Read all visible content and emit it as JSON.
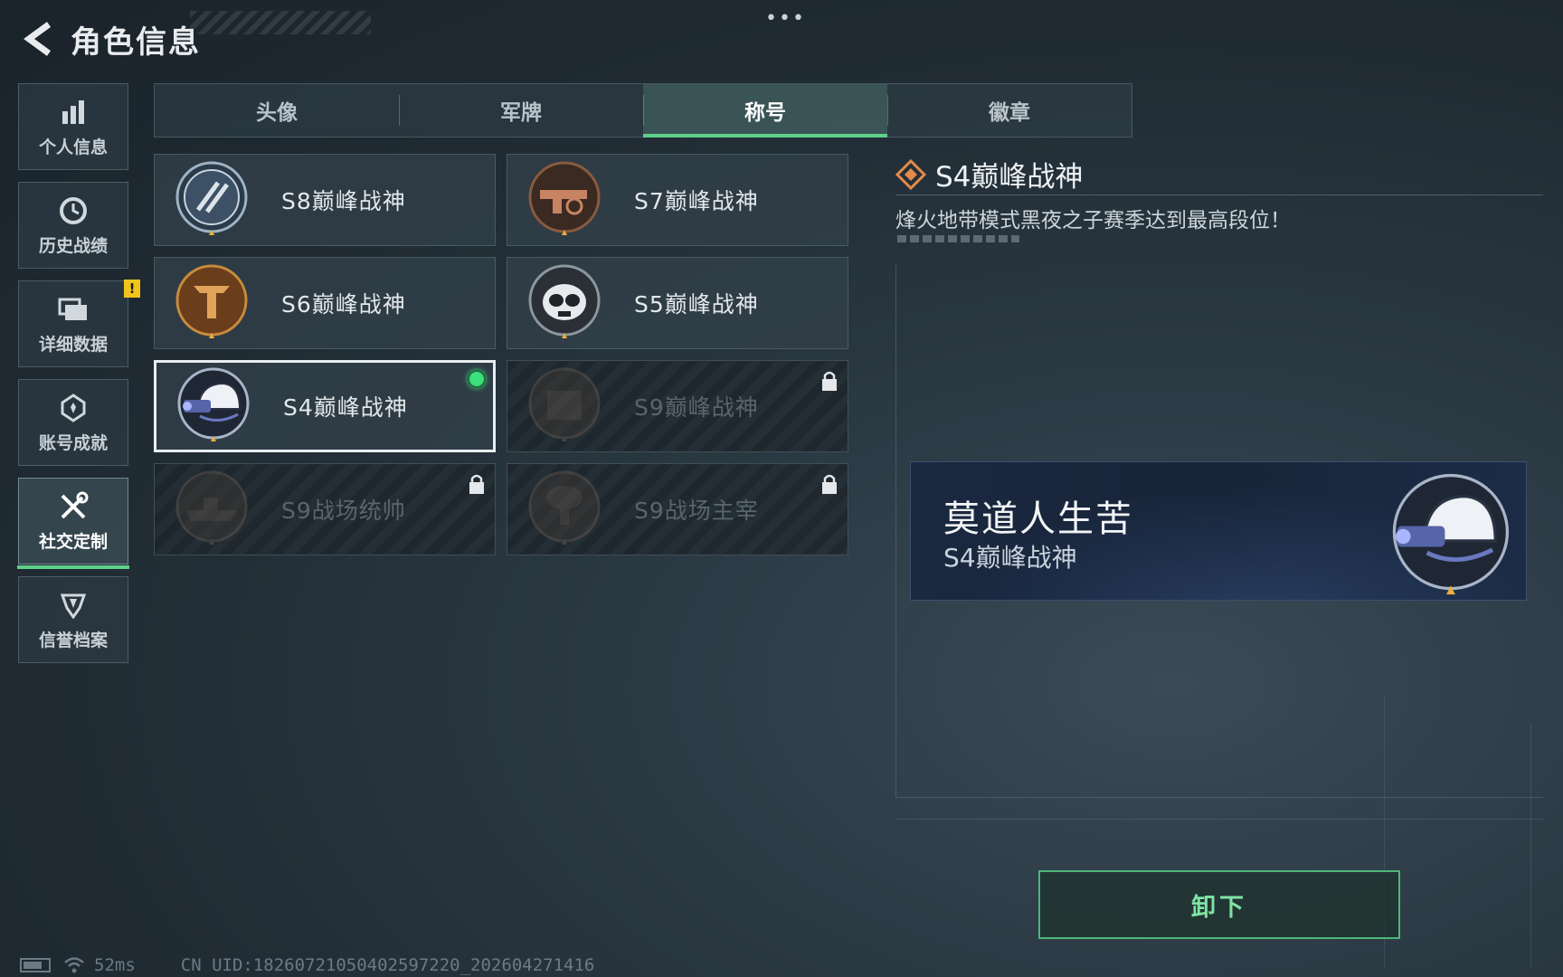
{
  "header": {
    "title": "角色信息",
    "more": "•••"
  },
  "sidebar": {
    "items": [
      {
        "label": "个人信息",
        "icon": "bar-chart-icon"
      },
      {
        "label": "历史战绩",
        "icon": "clock-icon"
      },
      {
        "label": "详细数据",
        "icon": "folder-icon",
        "badge": "!"
      },
      {
        "label": "账号成就",
        "icon": "achievement-icon"
      },
      {
        "label": "社交定制",
        "icon": "tools-icon",
        "active": true
      },
      {
        "label": "信誉档案",
        "icon": "shield-icon"
      }
    ]
  },
  "tabs": [
    {
      "label": "头像"
    },
    {
      "label": "军牌"
    },
    {
      "label": "称号",
      "active": true
    },
    {
      "label": "徽章"
    }
  ],
  "titles": [
    {
      "name": "S8巅峰战神",
      "emblem": "s8-emblem-icon",
      "locked": false
    },
    {
      "name": "S7巅峰战神",
      "emblem": "s7-emblem-icon",
      "locked": false
    },
    {
      "name": "S6巅峰战神",
      "emblem": "s6-emblem-icon",
      "locked": false
    },
    {
      "name": "S5巅峰战神",
      "emblem": "s5-emblem-icon",
      "locked": false
    },
    {
      "name": "S4巅峰战神",
      "emblem": "s4-emblem-icon",
      "locked": false,
      "selected": true,
      "equipped": true
    },
    {
      "name": "S9巅峰战神",
      "emblem": "s9-emblem-icon",
      "locked": true
    },
    {
      "name": "S9战场统帅",
      "emblem": "warship-emblem-icon",
      "locked": true
    },
    {
      "name": "S9战场主宰",
      "emblem": "mushroom-cloud-emblem-icon",
      "locked": true
    }
  ],
  "detail": {
    "title": "S4巅峰战神",
    "description": "烽火地带模式黑夜之子赛季达到最高段位！"
  },
  "nameplate": {
    "player_name": "莫道人生苦",
    "title": "S4巅峰战神"
  },
  "actions": {
    "unequip_label": "卸下"
  },
  "status_bar": {
    "ping": "52ms",
    "uid": "CN UID:1826072105040259722​0_202604271416"
  },
  "colors": {
    "accent_green": "#5fd08a",
    "equipped_dot": "#3be07a",
    "badge_yellow": "#f0c419"
  }
}
